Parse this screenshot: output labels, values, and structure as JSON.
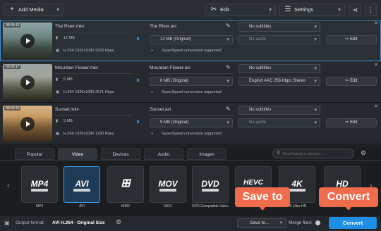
{
  "toolbar": {
    "add_media": "Add Media",
    "edit": "Edit",
    "settings": "Settings"
  },
  "files": [
    {
      "duration": "00:00:10",
      "name": "The River.mkv",
      "size": "12 MB",
      "meta": "H.264 1920x1080 9293 Kbps",
      "out_name": "The River.avi",
      "out_size": "12 MB (Original)",
      "speed": "SuperSpeed conversion supported",
      "subtitles": "No subtitles",
      "audio": "No audio",
      "edit": "Edit"
    },
    {
      "duration": "00:00:17",
      "name": "Mountain Flower.mkv",
      "size": "6 MB",
      "meta": "H.264 1920x1080 2571 Kbps",
      "out_name": "Mountain Flower.avi",
      "out_size": "6 MB (Original)",
      "speed": "SuperSpeed conversion supported",
      "subtitles": "No subtitles",
      "audio": "English AAC 256 Kbps Stereo",
      "edit": "Edit"
    },
    {
      "duration": "00:00:31",
      "name": "Sunset.mkv",
      "size": "5 MB",
      "meta": "H.264 1920x1080 1280 Kbps",
      "out_name": "Sunset.avi",
      "out_size": "5 MB (Original)",
      "speed": "SuperSpeed conversion supported",
      "subtitles": "No subtitles",
      "audio": "No audio",
      "edit": "Edit"
    }
  ],
  "tabs": [
    "Popular",
    "Video",
    "Devices",
    "Audio",
    "Images"
  ],
  "active_tab": "Video",
  "search": {
    "placeholder": "Find format or device..."
  },
  "formats": [
    {
      "icon": "MP4",
      "label": "MP4"
    },
    {
      "icon": "AVI",
      "label": "AVI"
    },
    {
      "icon": "windows-logo-icon",
      "label": "WMV"
    },
    {
      "icon": "MOV",
      "label": "MOV"
    },
    {
      "icon": "DVD",
      "label": "DVD-Compatible Video"
    },
    {
      "icon": "HEVC",
      "label": "HEVC Video"
    },
    {
      "icon": "4K",
      "label": "4K Ultra HD"
    },
    {
      "icon": "HD",
      "label": "HD Video"
    }
  ],
  "bottom": {
    "output_label": "Output format:",
    "output_value": "AVI H.264 - Original Size",
    "save_to": "Save to...",
    "merge": "Merge files:",
    "convert": "Convert"
  },
  "callouts": {
    "save_to": "Save to",
    "convert": "Convert"
  },
  "colors": {
    "accent": "#3c9be6",
    "callout": "#ef6c4c",
    "convert_button": "#1f8fe6"
  }
}
